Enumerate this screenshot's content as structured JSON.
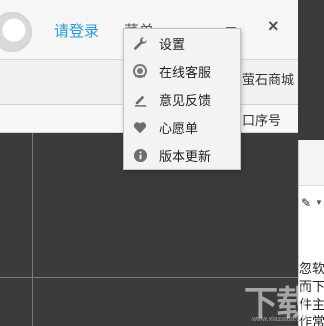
{
  "header": {
    "login": "请登录",
    "menu": "菜单",
    "close": "×"
  },
  "tabs": {
    "store": "萤石商城"
  },
  "table": {
    "col_seq": "口序号"
  },
  "menu_items": [
    {
      "label": "设置",
      "icon": "wrench-icon"
    },
    {
      "label": "在线客服",
      "icon": "headset-icon"
    },
    {
      "label": "意见反馈",
      "icon": "pencil-icon"
    },
    {
      "label": "心愿单",
      "icon": "heart-icon"
    },
    {
      "label": "版本更新",
      "icon": "info-icon"
    }
  ],
  "right_window": {
    "lines": [
      "忽软件",
      "而下载",
      "件主题",
      "作常代"
    ]
  },
  "watermark": {
    "text": "下载吧",
    "sub": "www.xiazaiba.com"
  }
}
